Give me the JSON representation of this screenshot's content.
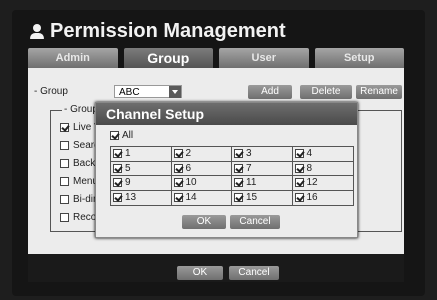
{
  "title": "Permission Management",
  "tabs": [
    "Admin",
    "Group",
    "User",
    "Setup"
  ],
  "active_tab": "Group",
  "group_label": "- Group",
  "group_value": "ABC",
  "buttons": {
    "add": "Add",
    "delete": "Delete",
    "rename": "Rename"
  },
  "group_section_label": "- Group",
  "permissions": [
    {
      "label": "Live View",
      "checked": true
    },
    {
      "label": "Search",
      "checked": false
    },
    {
      "label": "Backup",
      "checked": false
    },
    {
      "label": "Menu",
      "checked": false
    },
    {
      "label": "Bi-directional",
      "checked": false
    },
    {
      "label": "Record",
      "checked": false
    }
  ],
  "main_footer": {
    "ok": "OK",
    "cancel": "Cancel"
  },
  "dialog": {
    "title": "Channel Setup",
    "all_label": "All",
    "channels": [
      "1",
      "2",
      "3",
      "4",
      "5",
      "6",
      "7",
      "8",
      "9",
      "10",
      "11",
      "12",
      "13",
      "14",
      "15",
      "16"
    ],
    "ok": "OK",
    "cancel": "Cancel"
  }
}
